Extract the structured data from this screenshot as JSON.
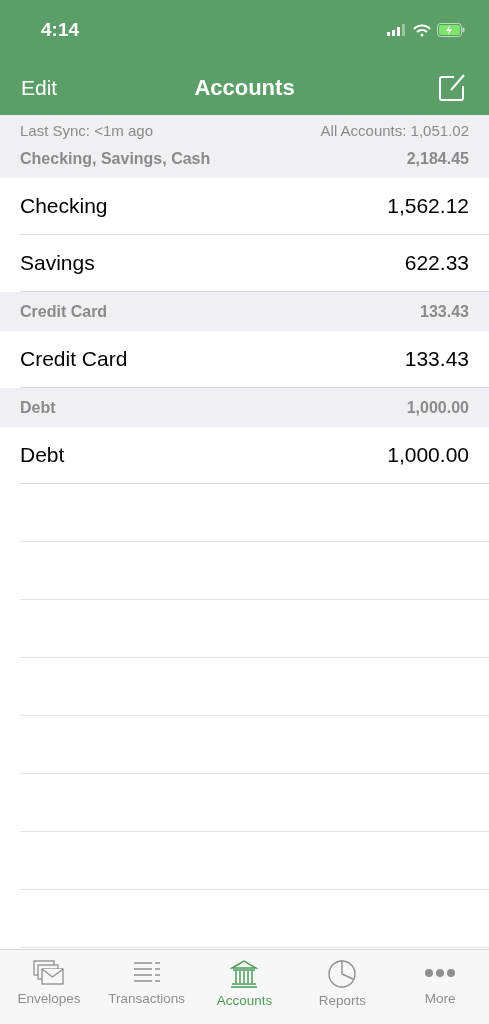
{
  "status_bar": {
    "time": "4:14"
  },
  "nav": {
    "left": "Edit",
    "title": "Accounts"
  },
  "sync": {
    "last_sync": "Last Sync: <1m ago",
    "all_accounts": "All Accounts: 1,051.02"
  },
  "sections": [
    {
      "name": "Checking, Savings, Cash",
      "total": "2,184.45",
      "accounts": [
        {
          "name": "Checking",
          "balance": "1,562.12"
        },
        {
          "name": "Savings",
          "balance": "622.33"
        }
      ]
    },
    {
      "name": "Credit Card",
      "total": "133.43",
      "accounts": [
        {
          "name": "Credit Card",
          "balance": "133.43"
        }
      ]
    },
    {
      "name": "Debt",
      "total": "1,000.00",
      "accounts": [
        {
          "name": "Debt",
          "balance": "1,000.00"
        }
      ]
    }
  ],
  "tabs": [
    {
      "label": "Envelopes",
      "kind": "envelopes",
      "selected": false
    },
    {
      "label": "Transactions",
      "kind": "transactions",
      "selected": false
    },
    {
      "label": "Accounts",
      "kind": "accounts",
      "selected": true
    },
    {
      "label": "Reports",
      "kind": "reports",
      "selected": false
    },
    {
      "label": "More",
      "kind": "more",
      "selected": false
    }
  ]
}
